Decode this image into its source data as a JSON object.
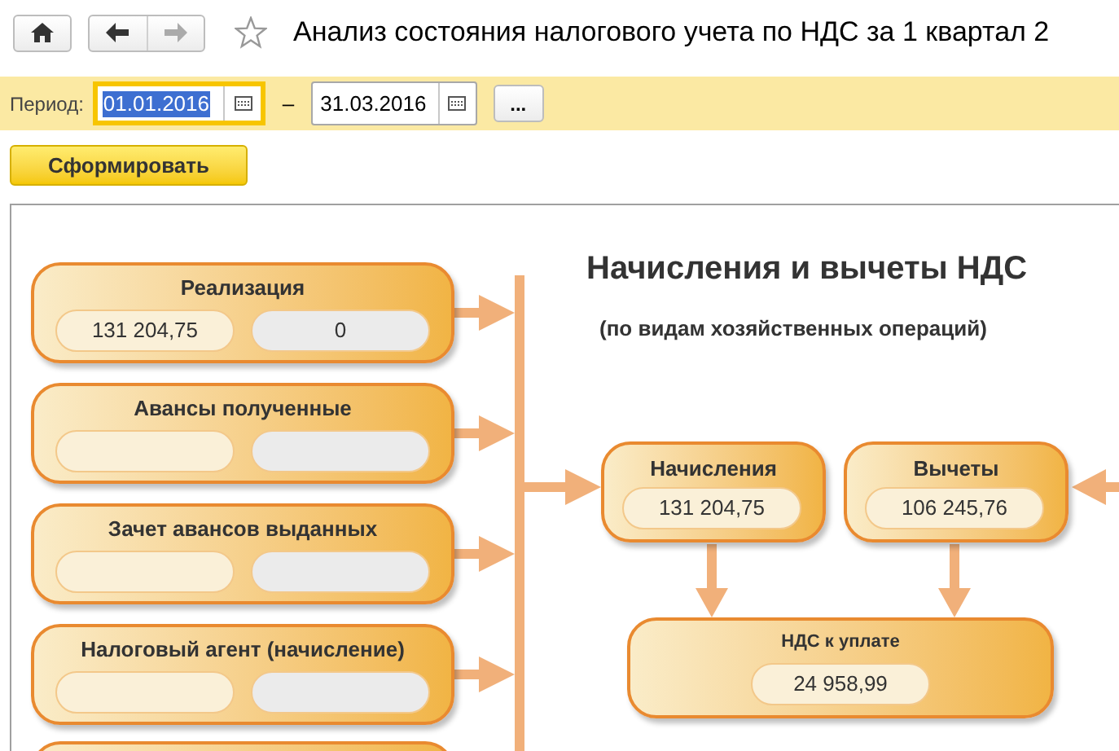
{
  "window": {
    "title": "Анализ состояния налогового учета по НДС за 1 квартал 2",
    "favorite": false
  },
  "filter": {
    "label": "Период:",
    "date_from": {
      "value": "01.01.2016",
      "focused": true
    },
    "separator": "–",
    "date_to": {
      "value": "31.03.2016",
      "focused": false
    },
    "more_button": "..."
  },
  "generate_button": "Сформировать",
  "report": {
    "title": "Начисления и вычеты НДС",
    "subtitle": "(по видам хозяйственных операций)",
    "operations": [
      {
        "title": "Реализация",
        "values": [
          "131 204,75",
          "0"
        ]
      },
      {
        "title": "Авансы полученные"
      },
      {
        "title": "Зачет авансов выданных"
      },
      {
        "title": "Налоговый агент (начисление)"
      }
    ],
    "accruals": {
      "title": "Начисления",
      "value": "131 204,75"
    },
    "deductions": {
      "title": "Вычеты",
      "value": "106 245,76"
    },
    "vat_payable": {
      "title": "НДС к уплате",
      "value": "24 958,99"
    }
  }
}
